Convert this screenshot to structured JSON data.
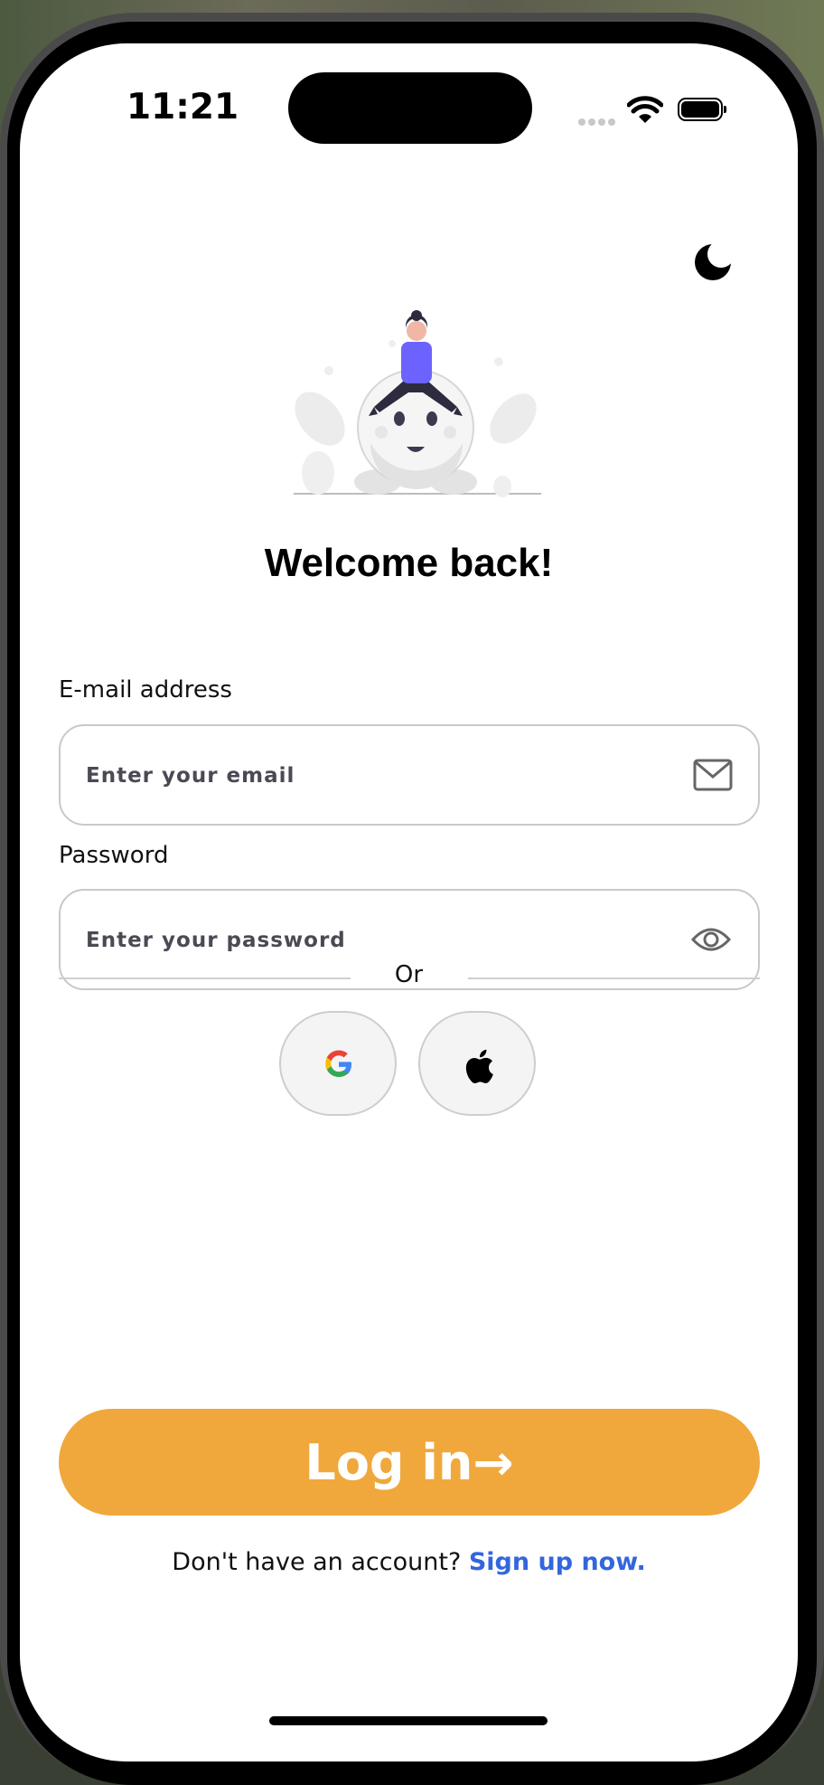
{
  "status_bar": {
    "time": "11:21"
  },
  "theme_toggle": {
    "icon": "moon-icon"
  },
  "illustration": {
    "icon": "person-sitting-on-moon-illustration"
  },
  "title": "Welcome back!",
  "email": {
    "label": "E-mail address",
    "placeholder": "Enter your email",
    "value": "",
    "icon": "mail-icon"
  },
  "password": {
    "label": "Password",
    "placeholder": "Enter your password",
    "value": "",
    "icon": "eye-icon"
  },
  "divider_text": "Or",
  "social": [
    {
      "name": "Google",
      "icon": "google-icon"
    },
    {
      "name": "Apple",
      "icon": "apple-icon"
    }
  ],
  "login_button": {
    "label": "Log in→",
    "color": "#f0a83c"
  },
  "signup": {
    "prompt": "Don't have an account? ",
    "link": "Sign up now.",
    "link_color": "#3366dd"
  }
}
